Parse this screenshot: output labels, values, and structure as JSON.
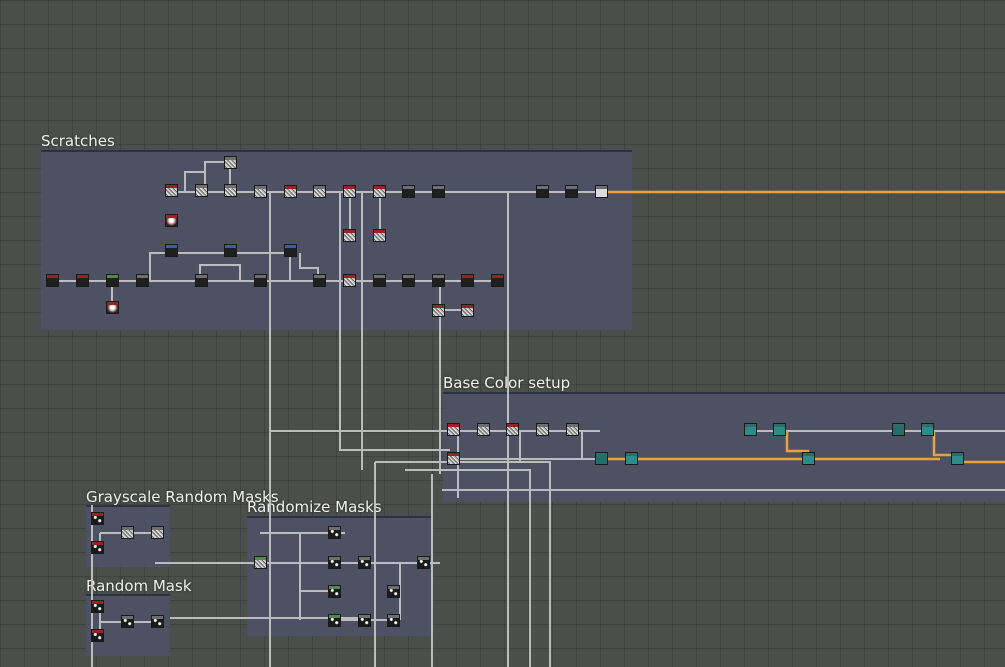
{
  "app": {
    "view": "node graph editor"
  },
  "frames": {
    "scratches": {
      "title": "Scratches"
    },
    "base_color_setup": {
      "title": "Base Color setup"
    },
    "grayscale_random_masks": {
      "title": "Grayscale Random Masks"
    },
    "randomize_masks": {
      "title": "Randomize Masks"
    },
    "random_mask": {
      "title": "Random Mask"
    }
  },
  "colors": {
    "canvas_bg": "#4b4f4b",
    "frame_bg": "#4e5268",
    "link_default": "#c8c8c8",
    "link_color": "#e8a23c",
    "node_header_red": "#9b2222",
    "node_teal": "#2d8c8a"
  },
  "icons": [
    "node-thumbnail-icon",
    "output-port-icon"
  ]
}
